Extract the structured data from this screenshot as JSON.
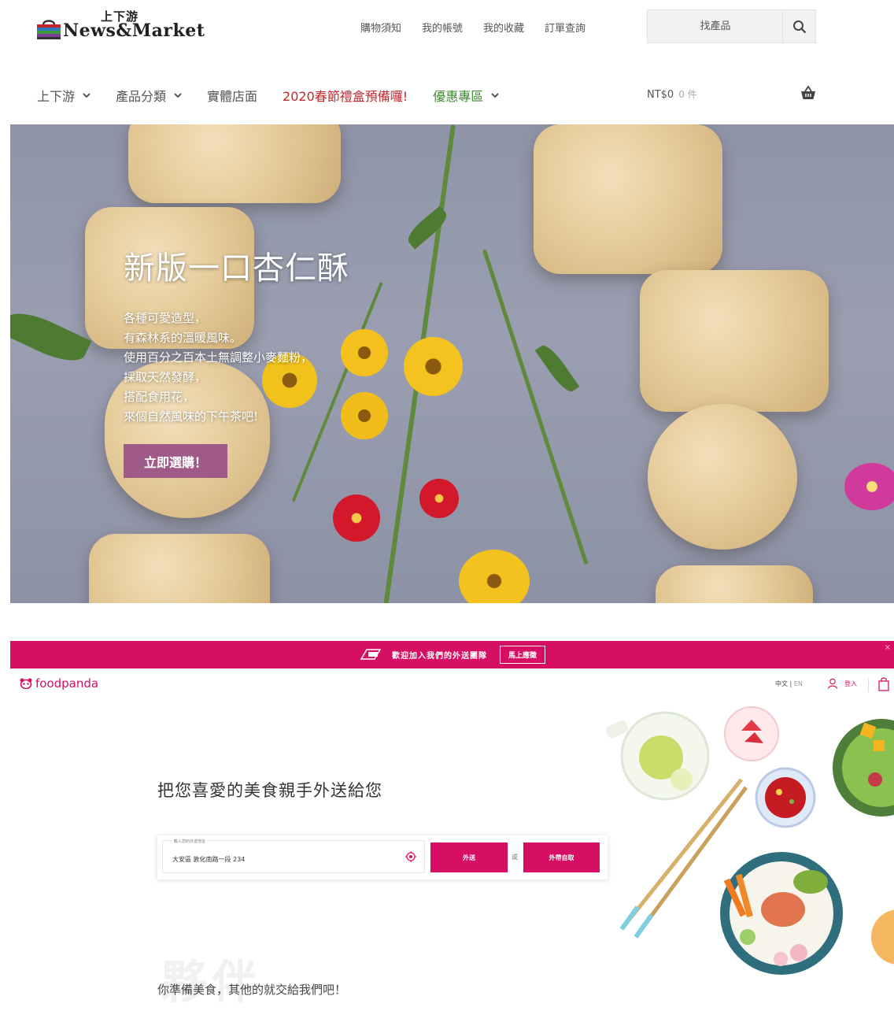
{
  "news_market": {
    "logo": {
      "subtitle": "上下游",
      "name": "News&Market"
    },
    "top_links": [
      "購物須知",
      "我的帳號",
      "我的收藏",
      "訂單查詢"
    ],
    "search": {
      "placeholder": "找產品"
    },
    "nav": {
      "items": [
        {
          "label": "上下游",
          "has_dropdown": true
        },
        {
          "label": "產品分類",
          "has_dropdown": true
        },
        {
          "label": "實體店面",
          "has_dropdown": false
        },
        {
          "label": "2020春節禮盒預備囉!",
          "has_dropdown": false
        },
        {
          "label": "優惠專區",
          "has_dropdown": true
        }
      ],
      "cart_total": "NT$0",
      "cart_count": "0 件"
    },
    "hero": {
      "title": "新版一口杏仁酥",
      "lines": [
        "各種可愛造型，",
        "有森林系的溫暖風味。",
        "使用百分之百本土無調整小麥麵粉，",
        "採取天然發酵，",
        "搭配食用花，",
        "來個自然風味的下午茶吧!"
      ],
      "cta": "立即選購！"
    },
    "colors": {
      "promo": "#c0272d",
      "deal": "#3c8a2e",
      "cta": "#a05a87"
    }
  },
  "foodpanda": {
    "banner": {
      "text": "歡迎加入我們的外送團隊",
      "button": "馬上應徵",
      "close": "×"
    },
    "logo": "foodpanda",
    "lang": {
      "zh": "中文",
      "en": "EN"
    },
    "login": "登入",
    "heading": "把您喜愛的美食親手外送給您",
    "form": {
      "label": "輸入您的外送地址",
      "address": "大安區 敦化南路一段 234",
      "delivery_btn": "外送",
      "or": "或",
      "pickup_btn": "外帶自取"
    },
    "watermark": "夥伴",
    "tagline": "你準備美食，其他的就交給我們吧！",
    "colors": {
      "brand": "#d70f64"
    }
  }
}
